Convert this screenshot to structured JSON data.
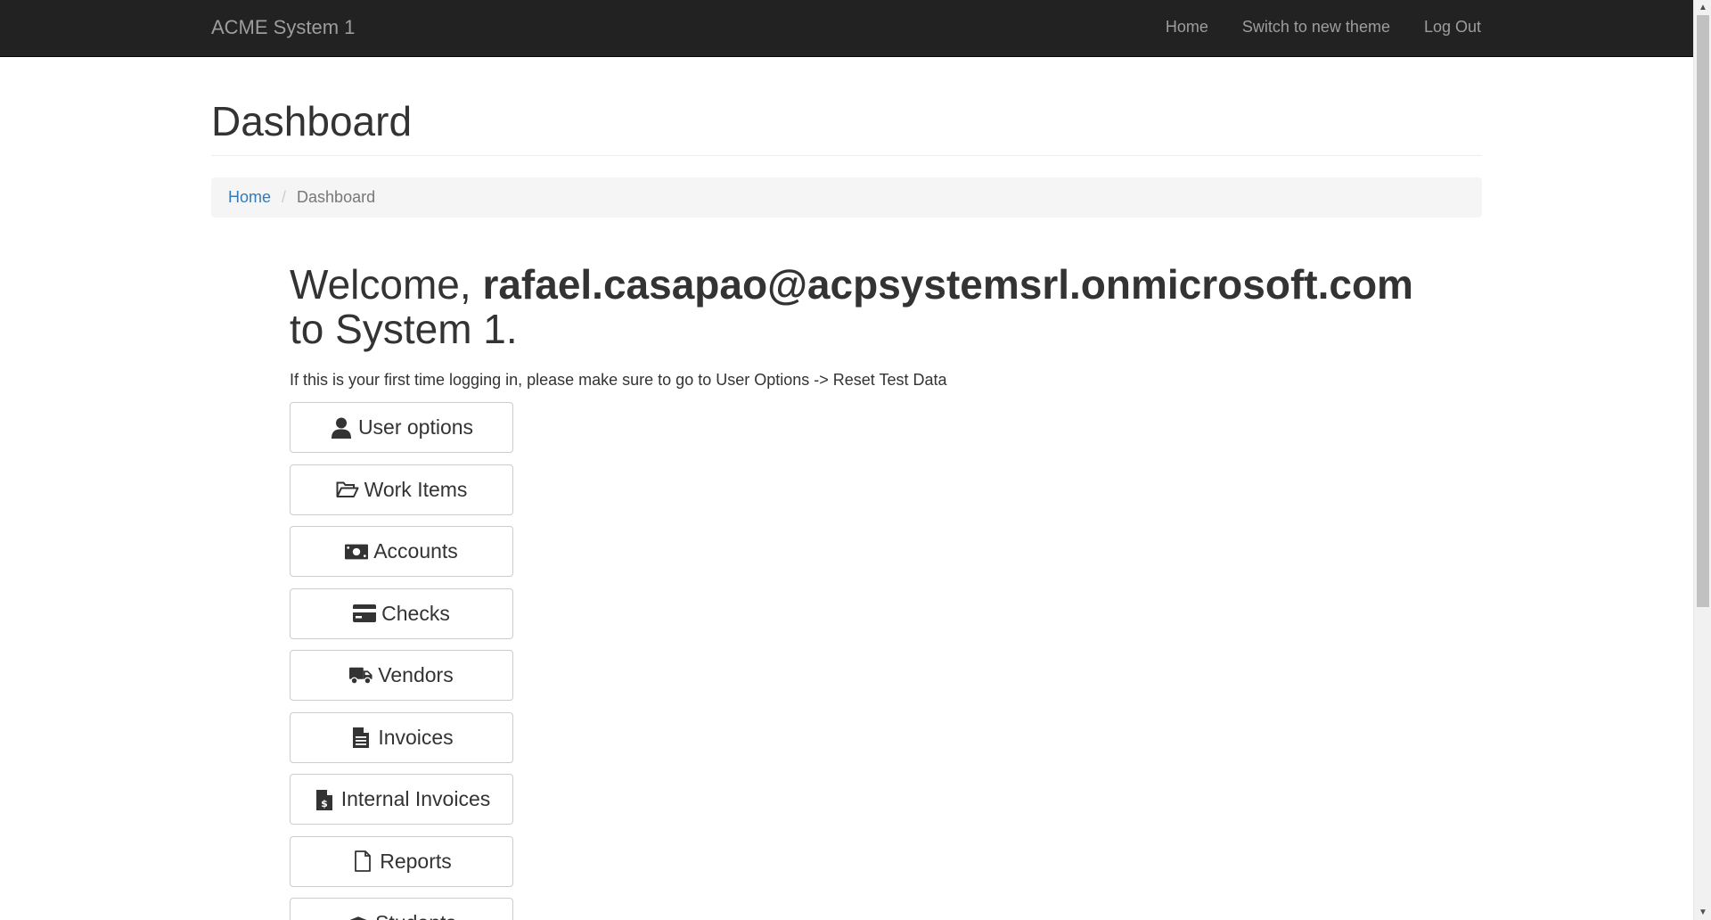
{
  "navbar": {
    "brand": "ACME System 1",
    "links": [
      {
        "label": "Home"
      },
      {
        "label": "Switch to new theme"
      },
      {
        "label": "Log Out"
      }
    ]
  },
  "page_title": "Dashboard",
  "breadcrumb": {
    "home": "Home",
    "separator": "/",
    "current": "Dashboard"
  },
  "welcome": {
    "prefix": "Welcome, ",
    "user": "rafael.casapao@acpsystemsrl.onmicrosoft.com",
    "suffix": "to System 1."
  },
  "hint": "If this is your first time logging in, please make sure to go to User Options -> Reset Test Data",
  "menu": [
    {
      "label": "User options",
      "icon": "user-icon"
    },
    {
      "label": "Work Items",
      "icon": "folder-open-icon"
    },
    {
      "label": "Accounts",
      "icon": "money-icon"
    },
    {
      "label": "Checks",
      "icon": "credit-card-icon"
    },
    {
      "label": "Vendors",
      "icon": "truck-icon"
    },
    {
      "label": "Invoices",
      "icon": "file-text-icon"
    },
    {
      "label": "Internal Invoices",
      "icon": "file-invoice-dollar-icon"
    },
    {
      "label": "Reports",
      "icon": "file-icon"
    },
    {
      "label": "Students",
      "icon": "graduation-cap-icon"
    }
  ],
  "colors": {
    "navbar_bg": "#222222",
    "navbar_text": "#9d9d9d",
    "link": "#337ab7",
    "breadcrumb_bg": "#f5f5f5"
  }
}
